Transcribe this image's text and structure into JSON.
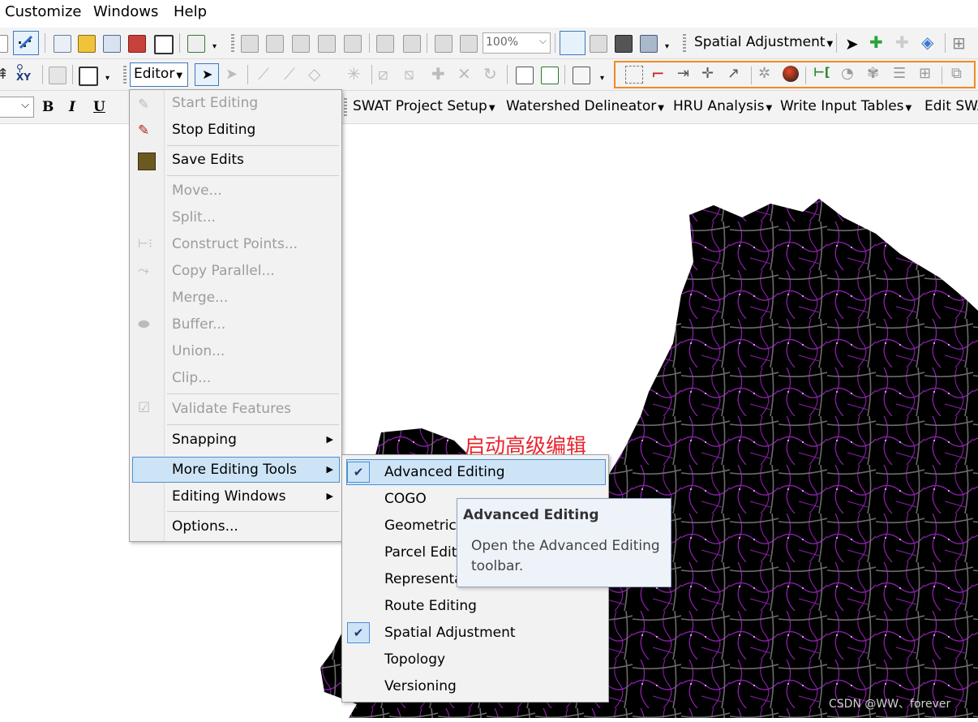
{
  "menubar": {
    "items": [
      "Customize",
      "Windows",
      "Help"
    ]
  },
  "toolbar1": {
    "zoom_value": "100%",
    "spatial_adjustment_label": "Spatial Adjustment"
  },
  "toolbar2": {
    "editor_label": "Editor"
  },
  "toolbar3": {
    "bold": "B",
    "italic": "I",
    "underline": "U",
    "swat_menus": [
      "SWAT Project Setup",
      "Watershed Delineator",
      "HRU Analysis",
      "Write Input Tables",
      "Edit SWA"
    ]
  },
  "editor_menu": {
    "items": [
      {
        "label": "Start Editing",
        "enabled": false,
        "icon": "start-editing-icon"
      },
      {
        "label": "Stop Editing",
        "enabled": true,
        "icon": "stop-editing-icon"
      },
      {
        "label": "Save Edits",
        "enabled": true,
        "icon": "save-edits-icon"
      },
      {
        "label": "Move...",
        "enabled": false
      },
      {
        "label": "Split...",
        "enabled": false
      },
      {
        "label": "Construct Points...",
        "enabled": false,
        "icon": "construct-points-icon"
      },
      {
        "label": "Copy Parallel...",
        "enabled": false,
        "icon": "copy-parallel-icon"
      },
      {
        "label": "Merge...",
        "enabled": false
      },
      {
        "label": "Buffer...",
        "enabled": false,
        "icon": "buffer-icon"
      },
      {
        "label": "Union...",
        "enabled": false
      },
      {
        "label": "Clip...",
        "enabled": false
      },
      {
        "label": "Validate Features",
        "enabled": false,
        "icon": "validate-icon"
      },
      {
        "label": "Snapping",
        "enabled": true,
        "submenu": true
      },
      {
        "label": "More Editing Tools",
        "enabled": true,
        "submenu": true,
        "highlighted": true
      },
      {
        "label": "Editing Windows",
        "enabled": true,
        "submenu": true
      },
      {
        "label": "Options...",
        "enabled": true
      }
    ]
  },
  "more_editing_tools_menu": {
    "items": [
      {
        "label": "Advanced Editing",
        "checked": true,
        "highlighted": true
      },
      {
        "label": "COGO",
        "checked": false
      },
      {
        "label": "Geometric",
        "checked": false
      },
      {
        "label": "Parcel Edit",
        "checked": false
      },
      {
        "label": "Representa",
        "checked": false
      },
      {
        "label": "Route Editing",
        "checked": false
      },
      {
        "label": "Spatial Adjustment",
        "checked": true
      },
      {
        "label": "Topology",
        "checked": false
      },
      {
        "label": "Versioning",
        "checked": false
      }
    ],
    "check_glyph": "✔"
  },
  "tooltip": {
    "title": "Advanced Editing",
    "body": "Open the Advanced Editing toolbar."
  },
  "annotation": {
    "text": "启动高级编辑",
    "color": "#e8232d"
  },
  "watermark": "CSDN @WW、forever",
  "colors": {
    "map_background": "#000000",
    "streams": "#8a1fa8",
    "subbasin_boundaries": "#6b6b6b",
    "highlight": "#cde4f7",
    "highlight_border": "#4c8fd3",
    "orange_box": "#f08a24"
  }
}
